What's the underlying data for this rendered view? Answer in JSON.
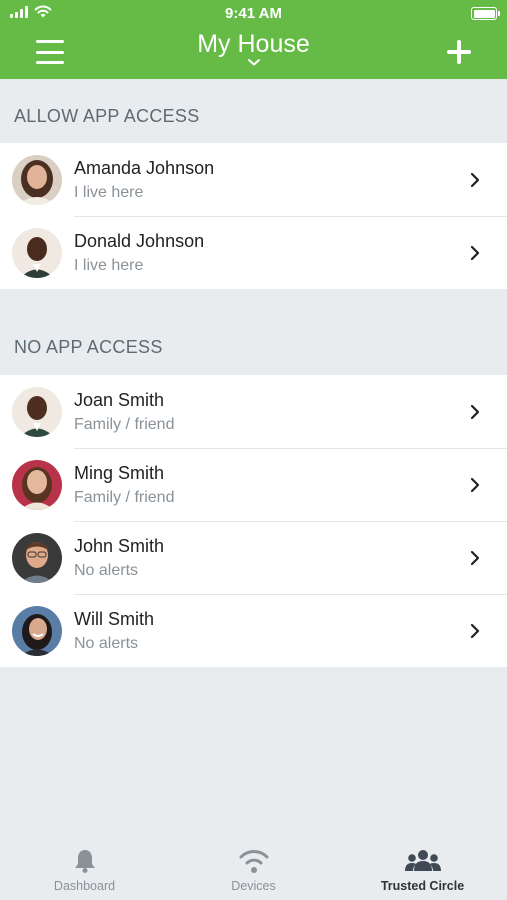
{
  "status_bar": {
    "time": "9:41 AM"
  },
  "header": {
    "title": "My House",
    "bg_color": "#66bb46"
  },
  "sections": [
    {
      "title": "ALLOW APP ACCESS",
      "people": [
        {
          "name": "Amanda Johnson",
          "subtitle": "I live here"
        },
        {
          "name": "Donald Johnson",
          "subtitle": "I live here"
        }
      ]
    },
    {
      "title": "NO APP ACCESS",
      "people": [
        {
          "name": "Joan Smith",
          "subtitle": "Family / friend"
        },
        {
          "name": "Ming Smith",
          "subtitle": "Family / friend"
        },
        {
          "name": "John Smith",
          "subtitle": "No alerts"
        },
        {
          "name": "Will Smith",
          "subtitle": "No alerts"
        }
      ]
    }
  ],
  "tabbar": {
    "tabs": [
      {
        "label": "Dashboard",
        "icon": "bell-icon"
      },
      {
        "label": "Devices",
        "icon": "wifi-icon"
      },
      {
        "label": "Trusted Circle",
        "icon": "people-group-icon",
        "active": true
      }
    ]
  }
}
